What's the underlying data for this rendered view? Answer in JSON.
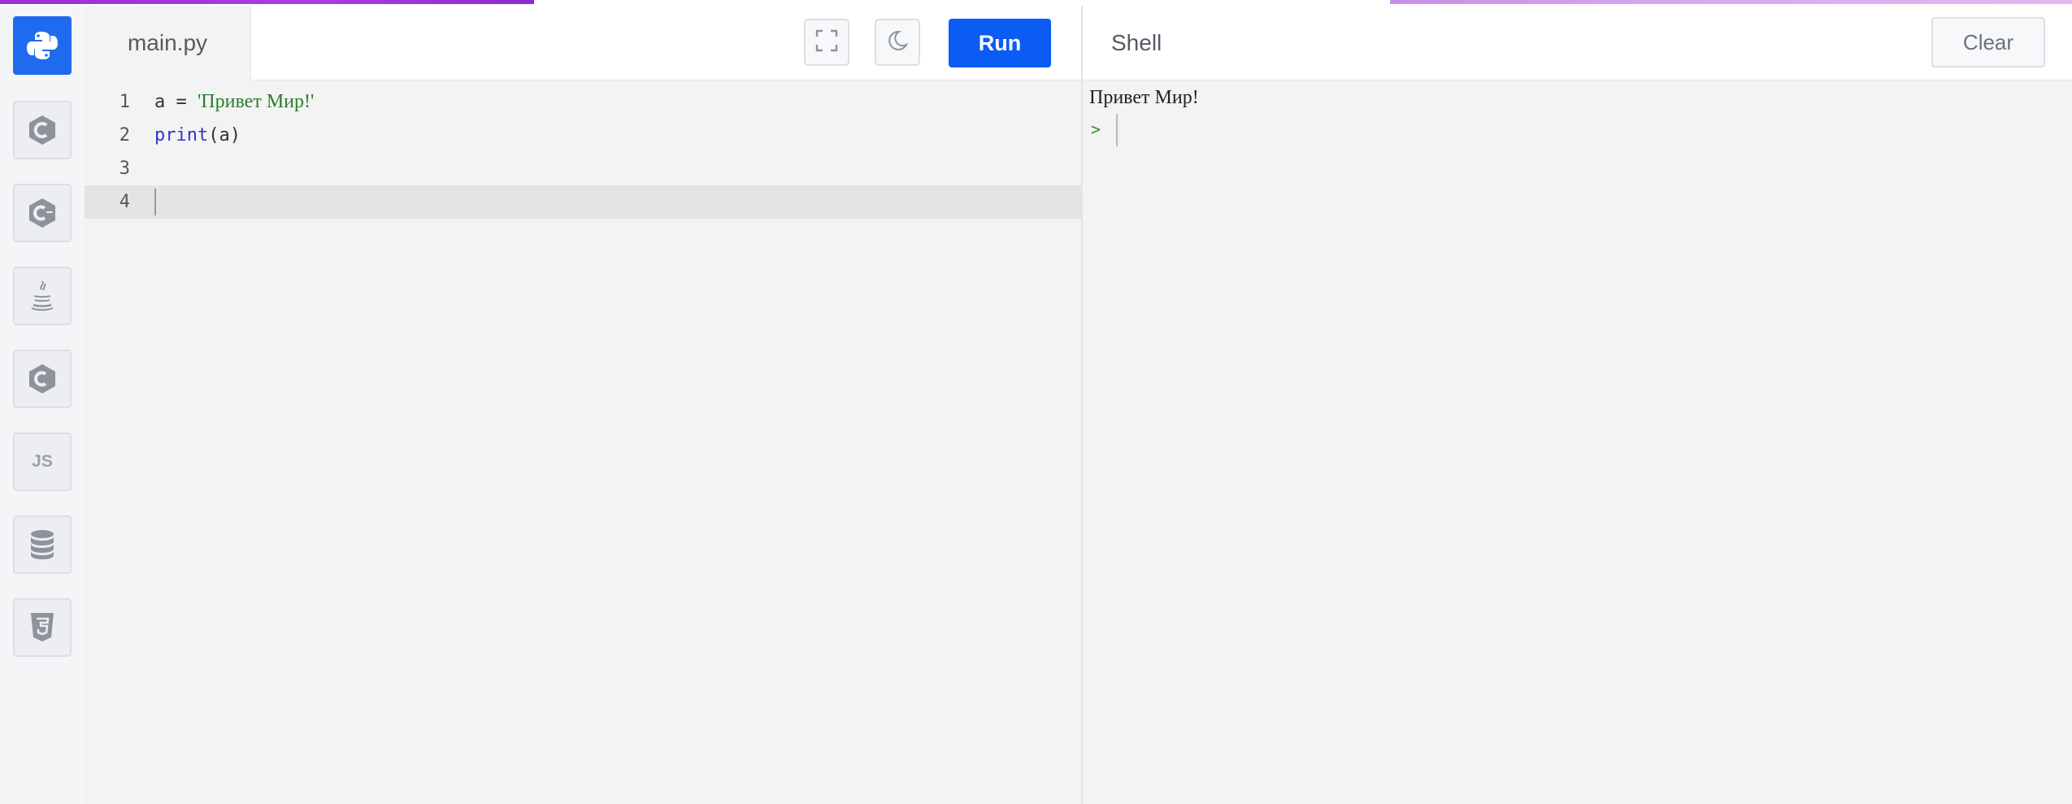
{
  "sidebar": {
    "languages": [
      {
        "id": "python",
        "icon": "python-icon",
        "active": true
      },
      {
        "id": "c",
        "icon": "c-icon"
      },
      {
        "id": "cpp",
        "icon": "cpp-icon"
      },
      {
        "id": "java",
        "icon": "java-icon"
      },
      {
        "id": "csharp",
        "icon": "csharp-icon"
      },
      {
        "id": "javascript",
        "icon": "js-icon",
        "text": "JS"
      },
      {
        "id": "sql",
        "icon": "database-icon"
      },
      {
        "id": "html",
        "icon": "html5-icon"
      }
    ]
  },
  "editor": {
    "file_name": "main.py",
    "run_label": "Run",
    "lines": [
      {
        "number": "1",
        "parts": [
          {
            "text": "a = ",
            "kind": "plain"
          },
          {
            "text": "'Привет Мир!'",
            "kind": "string"
          }
        ]
      },
      {
        "number": "2",
        "parts": [
          {
            "text": "print",
            "kind": "function"
          },
          {
            "text": "(a)",
            "kind": "plain"
          }
        ]
      },
      {
        "number": "3",
        "parts": []
      },
      {
        "number": "4",
        "parts": [],
        "current": true
      }
    ]
  },
  "shell": {
    "title": "Shell",
    "clear_label": "Clear",
    "output": "Привет Мир!",
    "prompt": ">"
  },
  "colors": {
    "accent": "#0b5cf2",
    "string": "#2a7d2e",
    "function": "#2b39c7",
    "top_strip_left": "#9b2fd8",
    "top_strip_right": "#d9a6ee"
  }
}
